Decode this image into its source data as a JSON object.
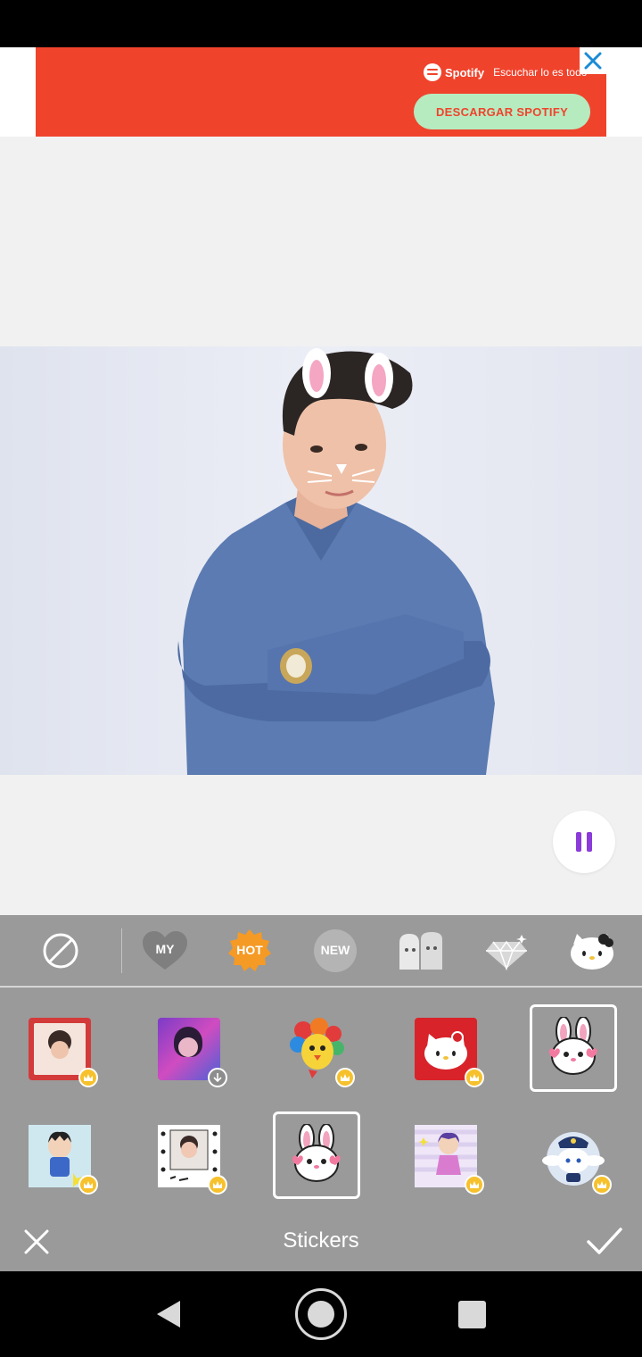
{
  "ad": {
    "brand": "Spotify",
    "tagline": "Escuchar lo es todo",
    "cta_label": "DESCARGAR SPOTIFY",
    "close_icon": "close-icon",
    "accent_color": "#f0432c"
  },
  "editor": {
    "photo_description_icon": "photo-canvas",
    "play_state_icon": "pause-icon",
    "accent_color": "#8b3bd9"
  },
  "tabs": {
    "none_icon": "no-sticker-icon",
    "my_label": "MY",
    "hot_label": "HOT",
    "new_label": "NEW",
    "pack_icons": [
      "sumikko-pack-icon",
      "diamond-pack-icon",
      "hello-kitty-pack-icon"
    ]
  },
  "stickers": {
    "row1": [
      "hello-kitty-frame-sticker",
      "neon-girl-sticker",
      "flower-bird-sticker",
      "hello-kitty-red-sticker",
      "bunny-face-sticker"
    ],
    "row2": [
      "astro-boy-sticker",
      "polaroid-dots-sticker",
      "bunny-face-sticker",
      "astro-girl-sticker",
      "cinnamoroll-police-sticker"
    ],
    "premium_badge_icon": "crown-icon",
    "download_badge_icon": "download-icon"
  },
  "bottom_bar": {
    "title": "Stickers",
    "cancel_icon": "close-icon",
    "confirm_icon": "check-icon"
  },
  "nav": {
    "back_icon": "back-triangle-icon",
    "home_icon": "home-circle-icon",
    "recents_icon": "recents-square-icon"
  }
}
